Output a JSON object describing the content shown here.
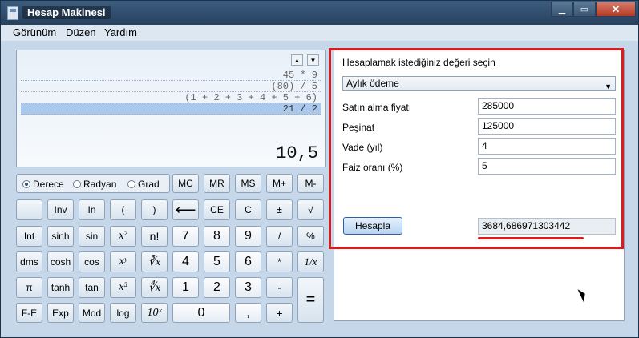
{
  "window": {
    "title": "Hesap Makinesi",
    "min_icon": "minimize-icon",
    "max_icon": "maximize-icon",
    "close_icon": "close-icon",
    "close_label": "✕"
  },
  "menu": {
    "items": [
      "Görünüm",
      "Düzen",
      "Yardım"
    ]
  },
  "display": {
    "history": [
      "45 * 9",
      "(80) / 5",
      "(1 + 2 + 3 + 4 + 5 + 6)",
      "21 / 2"
    ],
    "selected_index": 3,
    "value": "10,5",
    "scroll_up": "▲",
    "scroll_down": "▼"
  },
  "angle_modes": {
    "options": [
      "Derece",
      "Radyan",
      "Grad"
    ],
    "selected": "Derece"
  },
  "memory_keys": [
    "MC",
    "MR",
    "MS",
    "M+",
    "M-"
  ],
  "keys": {
    "row1": [
      "",
      "Inv",
      "In",
      "(",
      ")",
      "⟵",
      "CE",
      "C",
      "±",
      "√"
    ],
    "row2": [
      "Int",
      "sinh",
      "sin",
      "x²",
      "n!",
      "7",
      "8",
      "9",
      "/",
      "%"
    ],
    "row3": [
      "dms",
      "cosh",
      "cos",
      "xʸ",
      "∛x",
      "4",
      "5",
      "6",
      "*",
      "1/x"
    ],
    "row4": [
      "π",
      "tanh",
      "tan",
      "x³",
      "∜x",
      "1",
      "2",
      "3",
      "-"
    ],
    "row5": [
      "F-E",
      "Exp",
      "Mod",
      "log",
      "10ˣ",
      "0",
      ",",
      "+"
    ],
    "equals": "="
  },
  "worksheet": {
    "prompt": "Hesaplamak istediğiniz değeri seçin",
    "selected_option": "Aylık ödeme",
    "fields": [
      {
        "label": "Satın alma fiyatı",
        "value": "285000"
      },
      {
        "label": "Peşinat",
        "value": "125000"
      },
      {
        "label": "Vade (yıl)",
        "value": "4"
      },
      {
        "label": "Faiz oranı (%)",
        "value": "5"
      }
    ],
    "calculate_label": "Hesapla",
    "result": "3684,686971303442"
  },
  "colors": {
    "highlight": "#dc1c1c",
    "titlebar": "#2f4b6b"
  }
}
